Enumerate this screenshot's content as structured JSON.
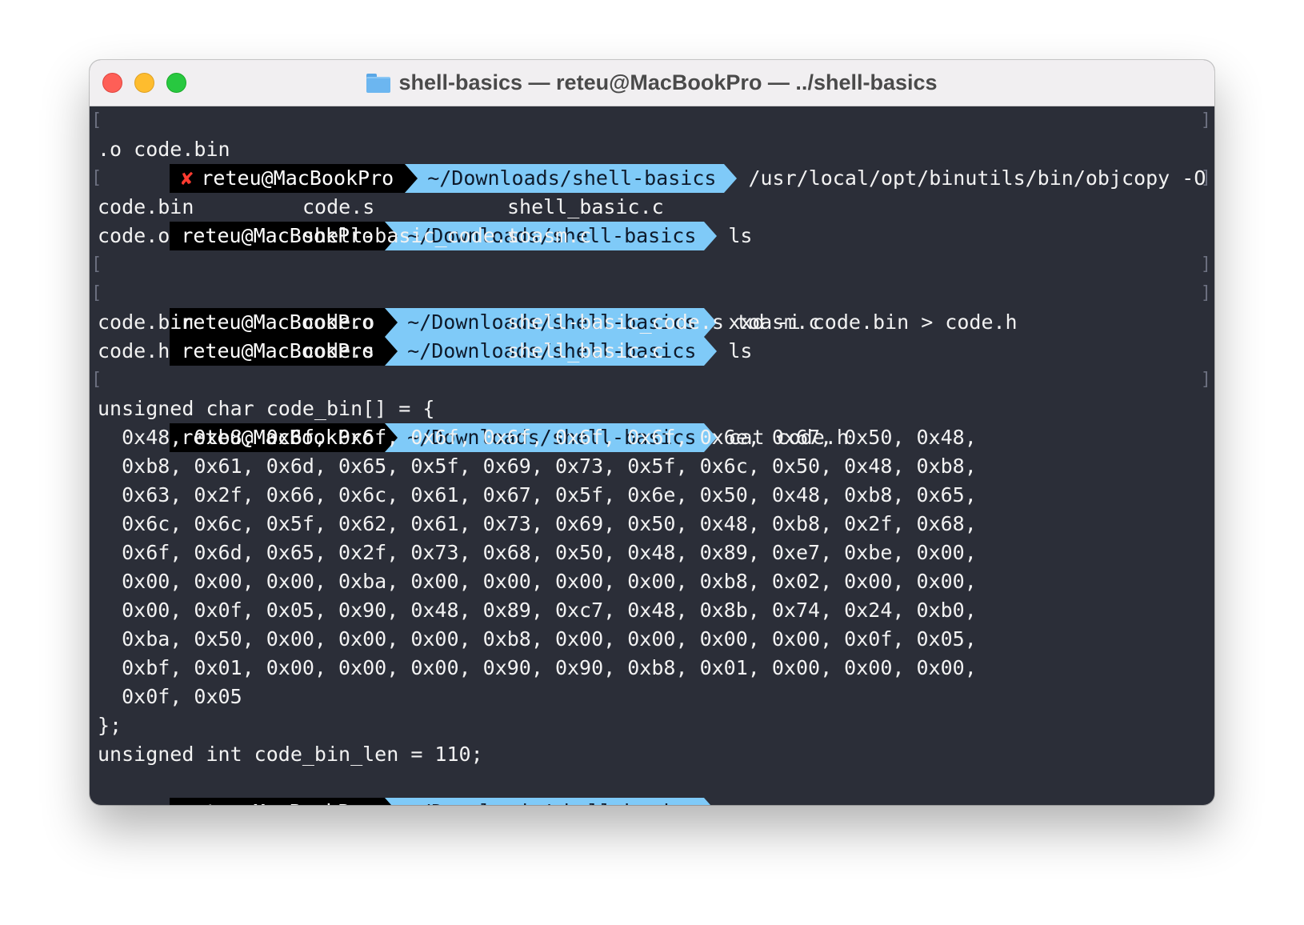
{
  "window": {
    "title": "shell-basics — reteu@MacBookPro — ../shell-basics"
  },
  "prompt": {
    "user": "reteu@MacBookPro",
    "path": "~/Downloads/shell-basics",
    "error_mark": "✘"
  },
  "lines": {
    "cmd1": "/usr/local/opt/binutils/bin/objcopy -O binary code",
    "cmd1_wrap": ".o code.bin",
    "cmd2": "ls",
    "ls1_r1": [
      "code.bin",
      "code.s",
      "shell_basic.c"
    ],
    "ls1_r2": [
      "code.o",
      "shell-basic_code.s",
      "toasm.c"
    ],
    "cmd3": "xxd -i code.bin > code.h",
    "cmd4": "ls",
    "ls2_r1": [
      "code.bin",
      "code.o",
      "shell-basic_code.s toasm.c"
    ],
    "ls2_r2": [
      "code.h",
      "code.s",
      "shell_basic.c"
    ],
    "cmd5": "cat code.h",
    "out_header": "unsigned char code_bin[] = {",
    "hex": [
      "  0x48, 0xb8, 0x6f, 0x6f, 0x6f, 0x6f, 0x6f, 0x6f, 0x6e, 0x67, 0x50, 0x48,",
      "  0xb8, 0x61, 0x6d, 0x65, 0x5f, 0x69, 0x73, 0x5f, 0x6c, 0x50, 0x48, 0xb8,",
      "  0x63, 0x2f, 0x66, 0x6c, 0x61, 0x67, 0x5f, 0x6e, 0x50, 0x48, 0xb8, 0x65,",
      "  0x6c, 0x6c, 0x5f, 0x62, 0x61, 0x73, 0x69, 0x50, 0x48, 0xb8, 0x2f, 0x68,",
      "  0x6f, 0x6d, 0x65, 0x2f, 0x73, 0x68, 0x50, 0x48, 0x89, 0xe7, 0xbe, 0x00,",
      "  0x00, 0x00, 0x00, 0xba, 0x00, 0x00, 0x00, 0x00, 0xb8, 0x02, 0x00, 0x00,",
      "  0x00, 0x0f, 0x05, 0x90, 0x48, 0x89, 0xc7, 0x48, 0x8b, 0x74, 0x24, 0xb0,",
      "  0xba, 0x50, 0x00, 0x00, 0x00, 0xb8, 0x00, 0x00, 0x00, 0x00, 0x0f, 0x05,",
      "  0xbf, 0x01, 0x00, 0x00, 0x00, 0x90, 0x90, 0xb8, 0x01, 0x00, 0x00, 0x00,",
      "  0x0f, 0x05"
    ],
    "out_close": "};",
    "out_len": "unsigned int code_bin_len = 110;"
  }
}
